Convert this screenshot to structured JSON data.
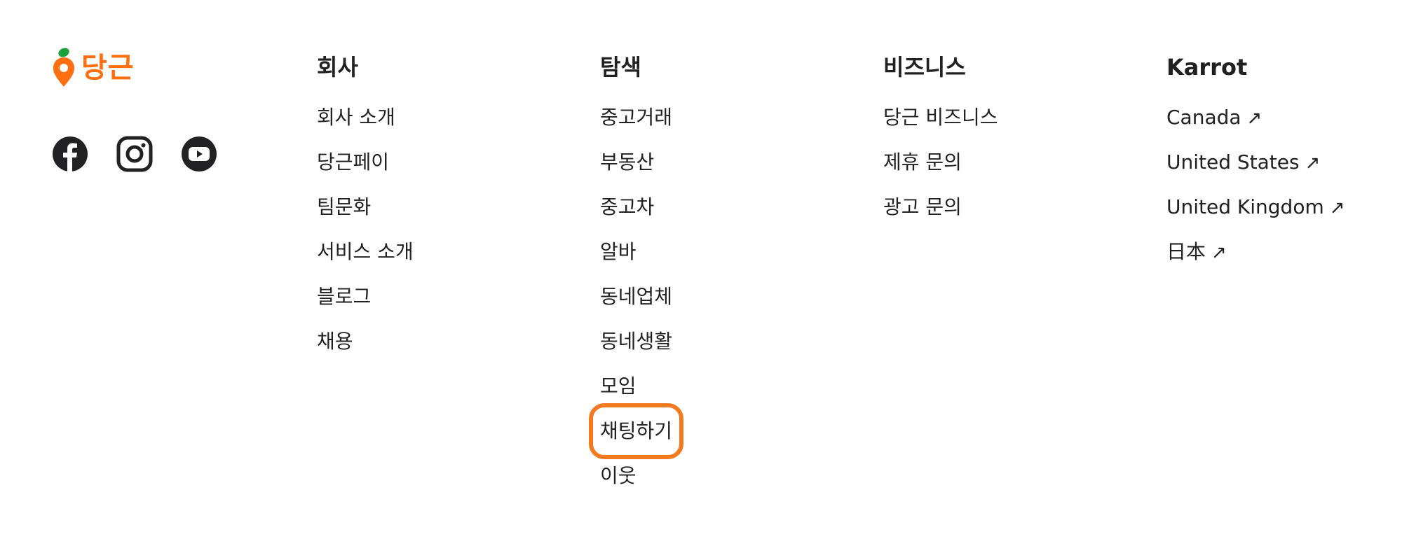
{
  "brand": {
    "name": "당근",
    "accent": "#ff6f0f",
    "leaf": "#1ba23a",
    "social_icons": [
      "facebook-icon",
      "instagram-icon",
      "youtube-icon"
    ]
  },
  "columns": [
    {
      "title": "회사",
      "items": [
        {
          "label": "회사 소개"
        },
        {
          "label": "당근페이"
        },
        {
          "label": "팀문화"
        },
        {
          "label": "서비스 소개"
        },
        {
          "label": "블로그"
        },
        {
          "label": "채용"
        }
      ]
    },
    {
      "title": "탐색",
      "items": [
        {
          "label": "중고거래"
        },
        {
          "label": "부동산"
        },
        {
          "label": "중고차"
        },
        {
          "label": "알바"
        },
        {
          "label": "동네업체"
        },
        {
          "label": "동네생활"
        },
        {
          "label": "모임"
        },
        {
          "label": "채팅하기"
        },
        {
          "label": "이웃"
        }
      ]
    },
    {
      "title": "비즈니스",
      "items": [
        {
          "label": "당근 비즈니스"
        },
        {
          "label": "제휴 문의"
        },
        {
          "label": "광고 문의"
        }
      ]
    },
    {
      "title": "Karrot",
      "items": [
        {
          "label": "Canada",
          "external_icon": "arrow-up-right-icon"
        },
        {
          "label": "United States",
          "external_icon": "arrow-up-right-icon"
        },
        {
          "label": "United Kingdom",
          "external_icon": "arrow-up-right-icon"
        },
        {
          "label": "日本",
          "external_icon": "arrow-up-right-icon"
        }
      ]
    }
  ],
  "highlight": {
    "column": 1,
    "item": 7,
    "color": "#f47a1f"
  }
}
